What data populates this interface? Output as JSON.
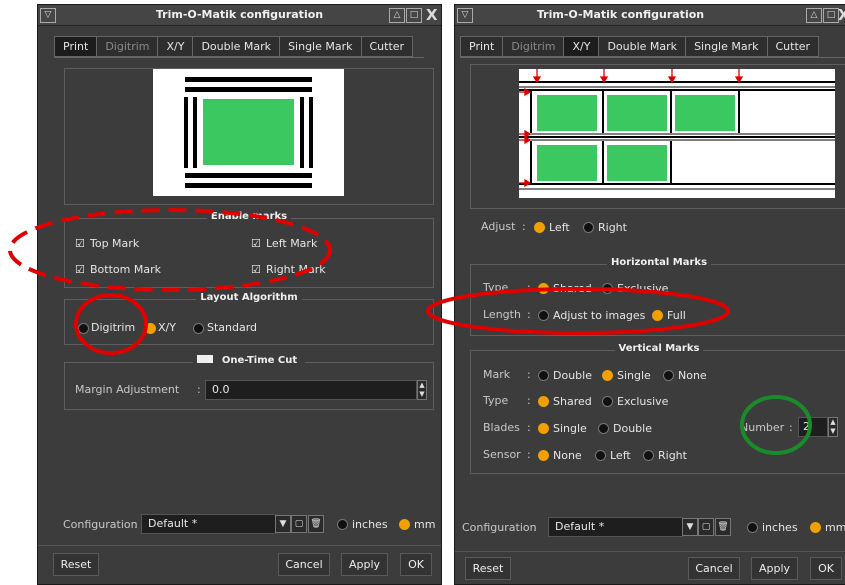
{
  "left_window": {
    "title": "Trim-O-Matik configuration",
    "tabs": [
      "Print",
      "Digitrim",
      "X/Y",
      "Double Mark",
      "Single Mark",
      "Cutter"
    ],
    "active_tab": "Print",
    "enable_marks": {
      "title": "Enable marks",
      "top_mark": "Top Mark",
      "left_mark": "Left Mark",
      "bottom_mark": "Bottom Mark",
      "right_mark": "Right Mark"
    },
    "layout": {
      "title": "Layout Algorithm",
      "options": [
        "Digitrim",
        "X/Y",
        "Standard"
      ],
      "selected": "X/Y"
    },
    "one_time_cut": {
      "title": "One-Time Cut",
      "margin_label": "Margin Adjustment",
      "margin_value": "0.0"
    },
    "configuration": {
      "label": "Configuration",
      "value": "Default *",
      "unit_inches": "inches",
      "unit_mm": "mm",
      "selected_unit": "mm"
    },
    "buttons": {
      "reset": "Reset",
      "cancel": "Cancel",
      "apply": "Apply",
      "ok": "OK"
    }
  },
  "right_window": {
    "title": "Trim-O-Matik configuration",
    "tabs": [
      "Print",
      "Digitrim",
      "X/Y",
      "Double Mark",
      "Single Mark",
      "Cutter"
    ],
    "active_tab": "X/Y",
    "adjust": {
      "label": "Adjust",
      "left": "Left",
      "right": "Right",
      "selected": "Left"
    },
    "horizontal_marks": {
      "title": "Horizontal Marks",
      "type_label": "Type",
      "type_shared": "Shared",
      "type_exclusive": "Exclusive",
      "length_label": "Length",
      "length_adjust": "Adjust to images",
      "length_full": "Full"
    },
    "vertical_marks": {
      "title": "Vertical Marks",
      "mark_label": "Mark",
      "mark_double": "Double",
      "mark_single": "Single",
      "mark_none": "None",
      "type_label": "Type",
      "type_shared": "Shared",
      "type_exclusive": "Exclusive",
      "blades_label": "Blades",
      "blades_single": "Single",
      "blades_double": "Double",
      "number_label": "Number",
      "number_value": "2",
      "sensor_label": "Sensor",
      "sensor_none": "None",
      "sensor_left": "Left",
      "sensor_right": "Right"
    },
    "configuration": {
      "label": "Configuration",
      "value": "Default *",
      "unit_inches": "inches",
      "unit_mm": "mm",
      "selected_unit": "mm"
    },
    "buttons": {
      "reset": "Reset",
      "cancel": "Cancel",
      "apply": "Apply",
      "ok": "OK"
    }
  },
  "colors": {
    "window_bg": "#3c3c3c",
    "radio_selected": "#f0a000",
    "preview_green": "#3cc860",
    "annotation_red": "#e00000",
    "annotation_green": "#1a8a2a",
    "arrow_red": "#e00000"
  },
  "icons": [
    "window-menu-icon",
    "shade-icon",
    "maximize-icon",
    "close-icon",
    "dropdown-icon",
    "new-config-icon",
    "trash-icon",
    "spin-arrows-icon",
    "checkbox-checked-icon"
  ]
}
